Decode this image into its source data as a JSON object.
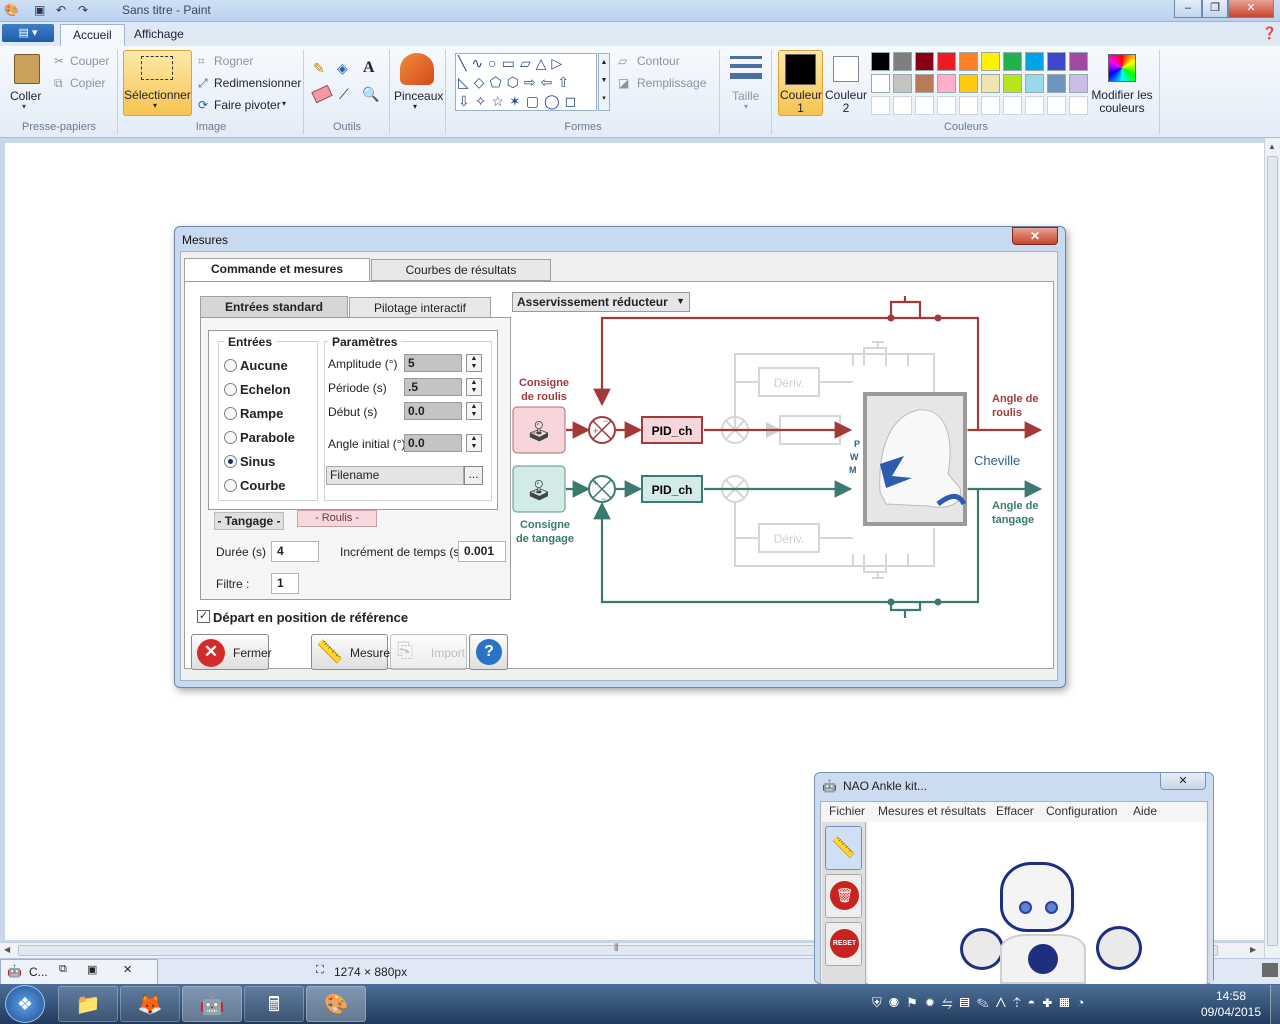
{
  "paint": {
    "title": "Sans titre - Paint",
    "tabs": [
      "Accueil",
      "Affichage"
    ],
    "file_menu": "▤ ▾",
    "clipboard": {
      "paste": "Coller",
      "cut": "Couper",
      "copy": "Copier",
      "label": "Presse-papiers"
    },
    "image": {
      "select": "Sélectionner",
      "crop": "Rogner",
      "resize": "Redimensionner",
      "rotate": "Faire pivoter",
      "label": "Image"
    },
    "tools": {
      "label": "Outils"
    },
    "brushes": {
      "label": "Pinceaux"
    },
    "shapes": {
      "outline": "Contour",
      "fill": "Remplissage",
      "label": "Formes"
    },
    "size": {
      "label": "Taille"
    },
    "colors": {
      "color1": "Couleur 1",
      "color2": "Couleur 2",
      "edit": "Modifier les couleurs",
      "label": "Couleurs",
      "palette_row1": [
        "#000000",
        "#7f7f7f",
        "#880015",
        "#ed1c24",
        "#ff7f27",
        "#fff200",
        "#22b14c",
        "#00a2e8",
        "#3f48cc",
        "#a349a4"
      ],
      "palette_row2": [
        "#ffffff",
        "#c3c3c3",
        "#b97a57",
        "#ffaec9",
        "#ffc90e",
        "#efe4b0",
        "#b5e61d",
        "#99d9ea",
        "#7092be",
        "#c8bfe7"
      ]
    },
    "status": {
      "size": "1274 × 880px"
    },
    "scroll_grip": "⦀"
  },
  "dialog": {
    "title": "Mesures",
    "close": "✕",
    "tabs": [
      "Commande et mesures",
      "Courbes de résultats"
    ],
    "subtabs": [
      "Entrées standard",
      "Pilotage interactif"
    ],
    "inputs_title": "Entrées",
    "inputs": [
      "Aucune",
      "Echelon",
      "Rampe",
      "Parabole",
      "Sinus",
      "Courbe"
    ],
    "selected_input": "Sinus",
    "params_title": "Paramètres",
    "params": [
      {
        "label": "Amplitude (°)",
        "value": "5"
      },
      {
        "label": "Période (s)",
        "value": ".5"
      },
      {
        "label": "Début (s)",
        "value": "0.0"
      },
      {
        "label": "Angle initial (°)",
        "value": "0.0"
      }
    ],
    "filename": "Filename",
    "browse": "...",
    "axis_tabs": [
      "- Tangage -",
      "- Roulis -"
    ],
    "duration_label": "Durée (s)",
    "duration": "4",
    "increment_label": "Incrément de temps (s)",
    "increment": "0.001",
    "filter_label": "Filtre :",
    "filter": "1",
    "reference_label": "Départ en position de référence",
    "buttons": {
      "close": "Fermer",
      "measure": "Mesure",
      "import": "Import",
      "help": "?"
    },
    "mode": "Asservissement réducteur",
    "diagram": {
      "roll_setpoint": "Consigne de roulis",
      "pitch_setpoint": "Consigne de tangage",
      "pid": "PID_ch",
      "deriv": "Dériv.",
      "pwm": "P W M",
      "ankle": "Cheville",
      "roll_angle": "Angle de roulis",
      "pitch_angle": "Angle de tangage"
    }
  },
  "nao": {
    "title": "NAO Ankle kit...",
    "menu": [
      "Fichier",
      "Mesures et résultats",
      "Effacer",
      "Configuration",
      "Aide"
    ],
    "reset": "RESET"
  },
  "taskbar": {
    "minimized_title": "C...",
    "time": "14:58",
    "date": "09/04/2015"
  }
}
